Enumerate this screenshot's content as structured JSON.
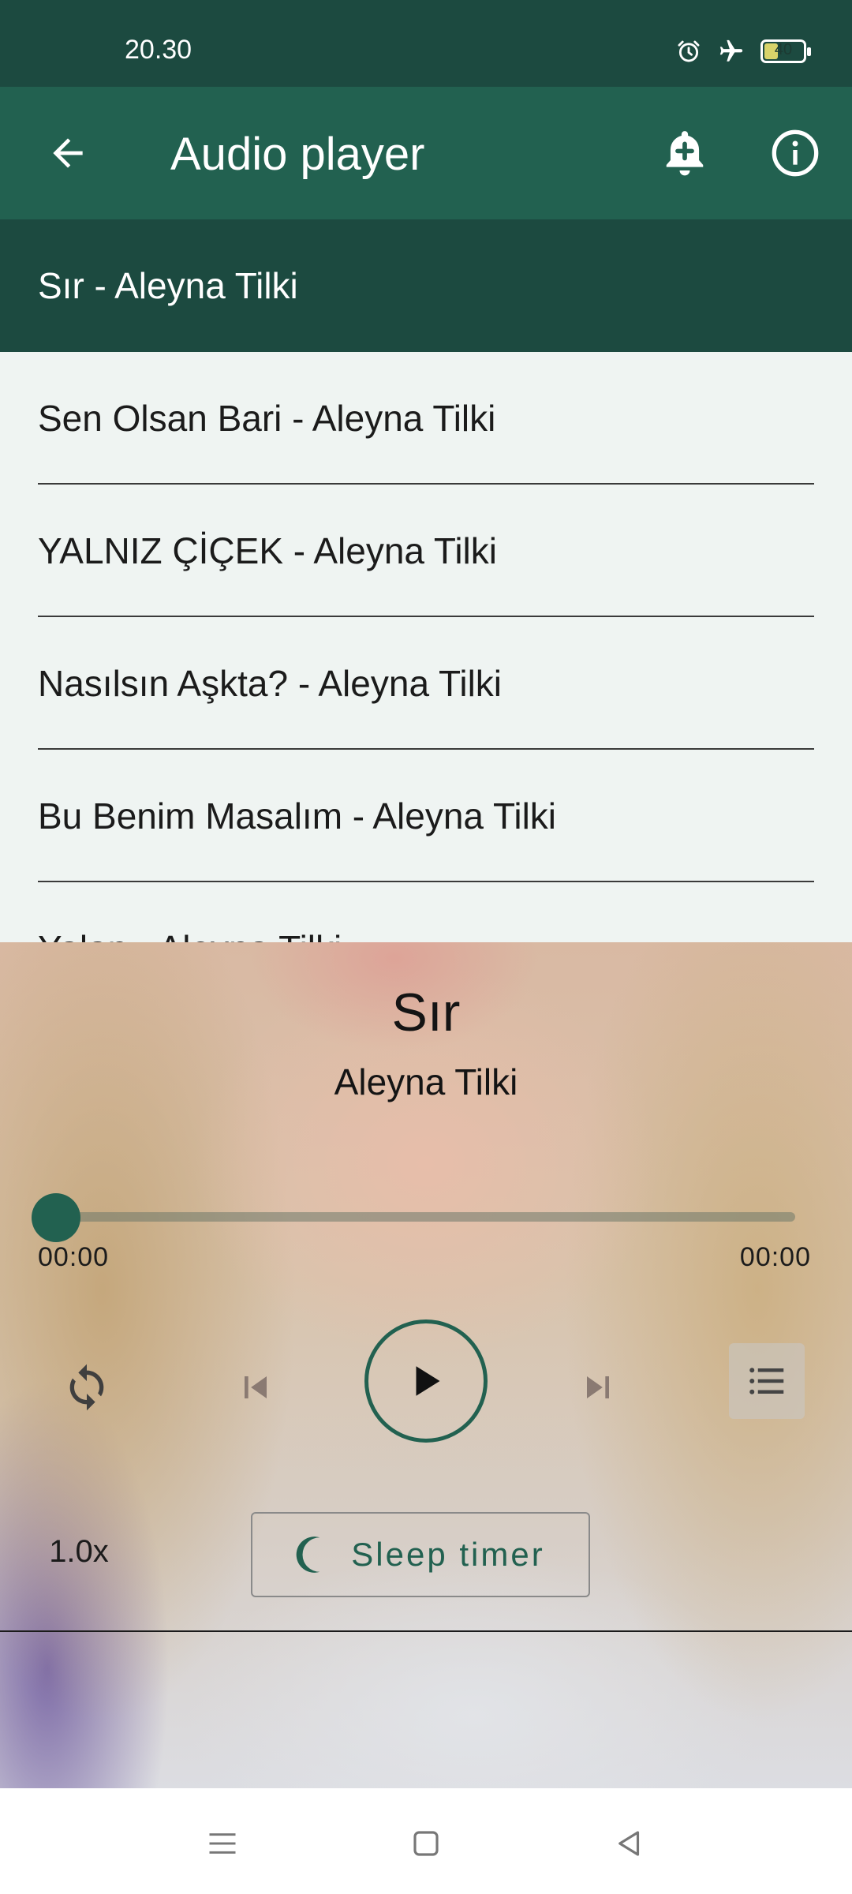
{
  "status_bar": {
    "time": "20.30",
    "icons": [
      "alarm-icon",
      "airplane-mode-icon",
      "battery-icon"
    ],
    "battery_level": "40",
    "battery_fraction": 0.4
  },
  "app_bar": {
    "title": "Audio player",
    "back_icon": "arrow-back-icon",
    "actions": [
      "add-alarm-bell-icon",
      "info-icon"
    ]
  },
  "playlist": {
    "items": [
      {
        "label": "Sır - Aleyna Tilki",
        "active": true
      },
      {
        "label": "Sen Olsan Bari - Aleyna Tilki",
        "active": false
      },
      {
        "label": "YALNIZ ÇİÇEK - Aleyna Tilki",
        "active": false
      },
      {
        "label": "Nasılsın Aşkta? - Aleyna Tilki",
        "active": false
      },
      {
        "label": "Bu Benim Masalım - Aleyna Tilki",
        "active": false
      },
      {
        "label": "Yalan - Aleyna Tilki",
        "active": false
      }
    ]
  },
  "player": {
    "title": "Sır",
    "artist": "Aleyna Tilki",
    "progress_fraction": 0,
    "time_current": "00:00",
    "time_total": "00:00",
    "controls": [
      "repeat-icon",
      "skip-previous-icon",
      "play-icon",
      "skip-next-icon",
      "queue-list-icon"
    ],
    "speed": "1.0x",
    "sleep_timer_label": "Sleep timer",
    "sleep_timer_icon": "moon-icon"
  },
  "nav_bar": {
    "icons": [
      "menu-icon",
      "home-icon",
      "back-icon"
    ]
  },
  "colors": {
    "status_bar": "#1c4a40",
    "app_bar": "#226150",
    "active_item": "#1c4a40",
    "accent": "#226150",
    "list_background": "#eff4f2"
  }
}
